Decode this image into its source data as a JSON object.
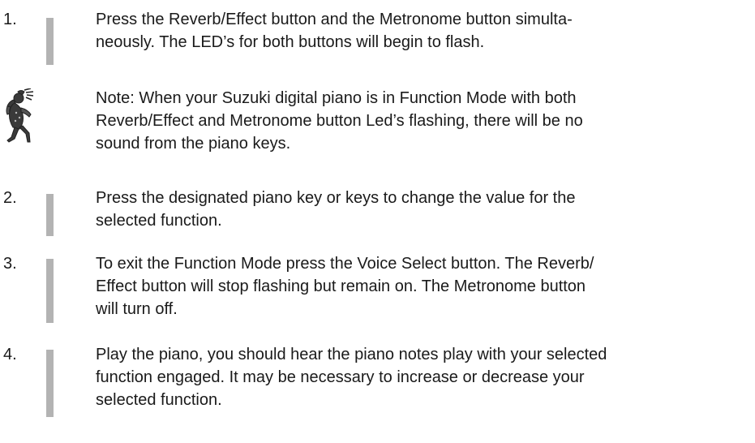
{
  "steps": [
    {
      "number": "1.",
      "lines": [
        "Press the Reverb/Effect button and the Metronome button simulta-",
        "neously.  The LED’s for both buttons will begin to flash."
      ]
    },
    {
      "number": "2.",
      "lines": [
        "Press the designated piano key or keys to change the value for the",
        "selected function."
      ]
    },
    {
      "number": "3.",
      "lines": [
        "To exit the Function Mode press the Voice Select button. The Reverb/",
        "Effect button  will stop flashing but remain on.  The Metronome button",
        "will turn off."
      ]
    },
    {
      "number": "4.",
      "lines": [
        "Play the piano, you should hear the piano notes play with your selected",
        "function engaged.  It may be necessary to increase or decrease your",
        "selected function."
      ]
    }
  ],
  "note": {
    "icon": "kokopelli-figure-icon",
    "lines": [
      "Note:  When your Suzuki digital piano is in Function Mode with both",
      "Reverb/Effect and Metronome button Led’s flashing, there will be no",
      "sound from the piano keys."
    ]
  }
}
